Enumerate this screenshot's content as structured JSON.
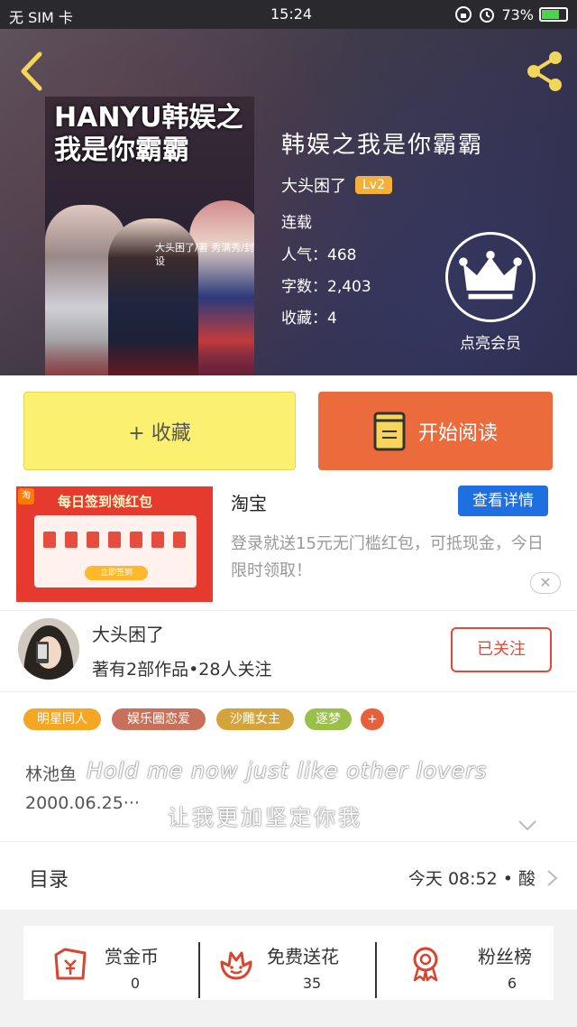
{
  "status_bar": {
    "left": "无 SIM 卡",
    "time": "15:24",
    "battery": "73%",
    "battery_level": 0.73
  },
  "book": {
    "title": "韩娱之我是你霸霸",
    "author": "大头困了",
    "author_level": "Lv2",
    "status": "连载",
    "popularity": "人气：468",
    "word_count": "字数：2,403",
    "favorites": "收藏：4",
    "cover_text": {
      "title": "HANYU韩娱之我是你霸霸",
      "credits": "大头困了/著 秀满秀/封设"
    }
  },
  "vip": {
    "label": "点亮会员"
  },
  "actions": {
    "collect_label": "+ 收藏",
    "read_label": "开始阅读"
  },
  "ad": {
    "title": "淘宝",
    "button": "查看详情",
    "description": "登录就送15元无门槛红包，可抵现金，今日限时领取！",
    "close": "✕",
    "image_text": {
      "tao": "淘",
      "headline": "每日签到领红包",
      "sign": "立即签到"
    }
  },
  "author_info": {
    "name": "大头困了",
    "stats": "著有2部作品•28人关注",
    "follow_label": "已关注"
  },
  "tags": [
    {
      "label": "明星同人",
      "color": "#f5a623"
    },
    {
      "label": "娱乐圈恋爱",
      "color": "#c8705a"
    },
    {
      "label": "沙雕女主",
      "color": "#d4a43a"
    },
    {
      "label": "逐梦",
      "color": "#9bc04a"
    },
    {
      "label": "+",
      "color": "#e8603a"
    }
  ],
  "description": {
    "line1": "林池鱼",
    "line2": "2000.06.25···",
    "lyric1": "Hold me now just like other lovers",
    "lyric2": "让我更加坚定你我"
  },
  "toc": {
    "label": "目录",
    "latest": "今天 08:52 • 酸"
  },
  "stats": [
    {
      "label": "赏金币",
      "value": "0",
      "icon": "money-envelope-icon"
    },
    {
      "label": "免费送花",
      "value": "35",
      "icon": "flower-icon"
    },
    {
      "label": "粉丝榜",
      "value": "6",
      "icon": "award-ribbon-icon"
    }
  ],
  "colors": {
    "accent_orange": "#ec6b3c",
    "accent_yellow": "#fbf06f",
    "link_blue": "#1e6fe0",
    "follow_red": "#e04a3a",
    "level_badge": "#f3b03a"
  }
}
